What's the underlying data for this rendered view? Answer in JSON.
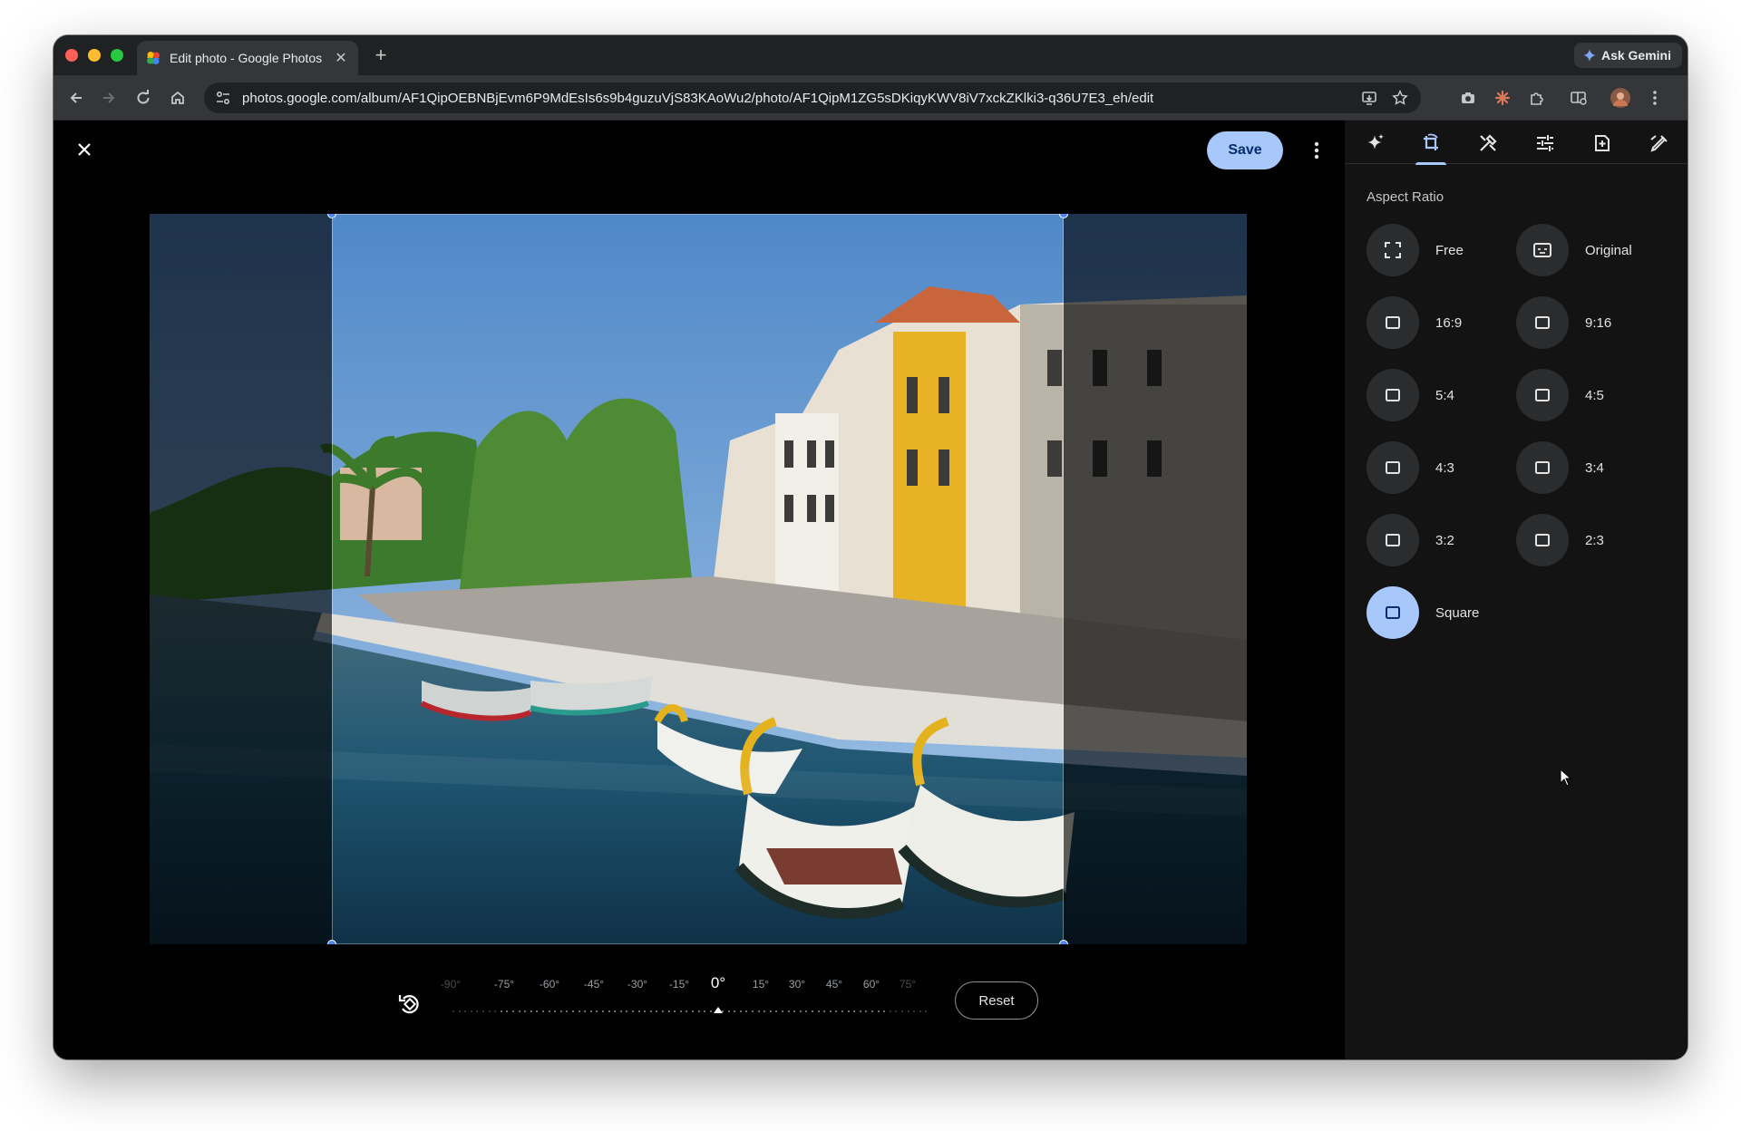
{
  "browser": {
    "tab_title": "Edit photo - Google Photos",
    "new_tab_label": "+",
    "ask_gemini": "Ask Gemini",
    "url": "photos.google.com/album/AF1QipOEBNBjEvm6P9MdEsIs6s9b4guzuVjS83KAoWu2/photo/AF1QipM1ZG5sDKiqyKWV8iV7xckZKlki3-q36U7E3_eh/edit"
  },
  "editor": {
    "save_label": "Save",
    "reset_label": "Reset",
    "rotation": {
      "labels": [
        "-90°",
        "-75°",
        "-60°",
        "-45°",
        "-30°",
        "-15°",
        "0°",
        "15°",
        "30°",
        "45°",
        "60°",
        "75°"
      ],
      "current_angle": "0°"
    },
    "photo_description_icon": "photo-canal-boats"
  },
  "panel": {
    "tools": [
      "suggestions-icon",
      "crop-rotate-icon",
      "tools-icon",
      "adjust-icon",
      "filters-icon",
      "markup-icon"
    ],
    "active_tool": "crop-rotate-icon",
    "heading": "Aspect Ratio",
    "ratios": [
      {
        "label": "Free",
        "icon": "free-crop-icon",
        "selected": false
      },
      {
        "label": "Original",
        "icon": "original-ratio-icon",
        "selected": false
      },
      {
        "label": "16:9",
        "icon": "ratio-icon",
        "selected": false
      },
      {
        "label": "9:16",
        "icon": "ratio-icon",
        "selected": false
      },
      {
        "label": "5:4",
        "icon": "ratio-icon",
        "selected": false
      },
      {
        "label": "4:5",
        "icon": "ratio-icon",
        "selected": false
      },
      {
        "label": "4:3",
        "icon": "ratio-icon",
        "selected": false
      },
      {
        "label": "3:4",
        "icon": "ratio-icon",
        "selected": false
      },
      {
        "label": "3:2",
        "icon": "ratio-icon",
        "selected": false
      },
      {
        "label": "2:3",
        "icon": "ratio-icon",
        "selected": false
      },
      {
        "label": "Square",
        "icon": "ratio-icon",
        "selected": true
      }
    ]
  },
  "colors": {
    "accent": "#a8c7fa",
    "handle": "#4d86f5"
  }
}
